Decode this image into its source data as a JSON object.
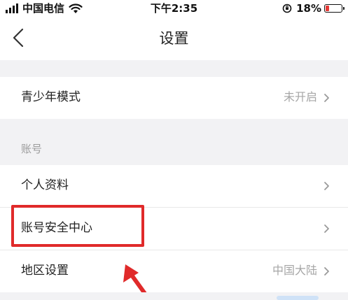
{
  "status_bar": {
    "carrier": "中国电信",
    "time": "下午2:35",
    "battery": "18%",
    "icons": [
      "signal-icon",
      "wifi-icon",
      "rotation-lock-icon",
      "battery-icon"
    ]
  },
  "nav": {
    "title": "设置",
    "back_icon": "chevron-left-icon"
  },
  "rows": {
    "teen_mode": {
      "label": "青少年模式",
      "value": "未开启"
    },
    "personal_info": {
      "label": "个人资料"
    },
    "account_security": {
      "label": "账号安全中心"
    },
    "region": {
      "label": "地区设置",
      "value": "中国大陆"
    }
  },
  "sections": {
    "account": "账号"
  },
  "colors": {
    "background": "#f2f2f4",
    "row_bg": "#ffffff",
    "annotation_red": "#e02a2a",
    "value_gray": "#a6a6a6",
    "battery_low": "#e53935"
  }
}
